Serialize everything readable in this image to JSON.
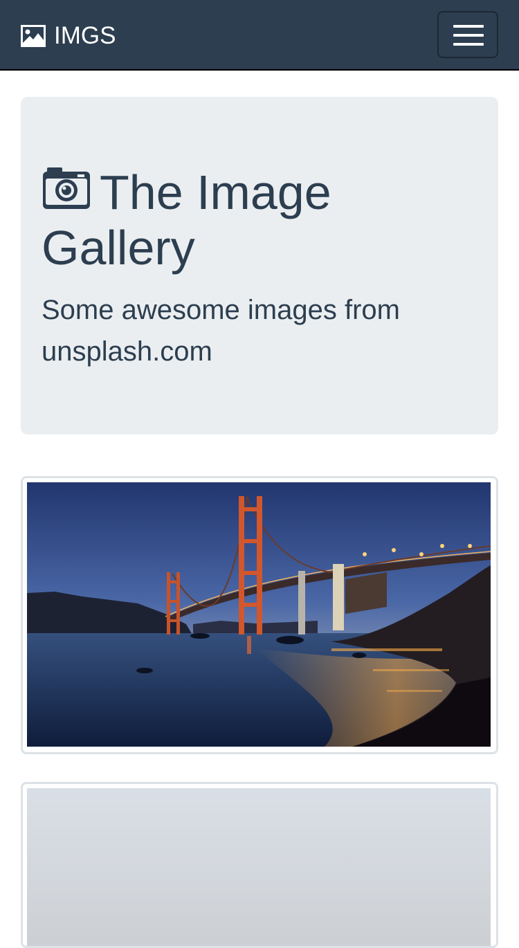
{
  "navbar": {
    "brand_icon": "image-icon",
    "brand_text": "IMGS",
    "toggler_icon": "hamburger-menu-icon",
    "background_color": "#2c3e50"
  },
  "jumbotron": {
    "title_icon": "camera-icon",
    "title": "The Image Gallery",
    "lead": "Some awesome images from unsplash.com",
    "background_color": "#ebeef0",
    "text_color": "#2c3e50"
  },
  "gallery": {
    "images": [
      {
        "subject": "golden-gate-bridge-at-dusk-photo"
      },
      {
        "subject": "misty-grey-sky-photo"
      }
    ]
  }
}
